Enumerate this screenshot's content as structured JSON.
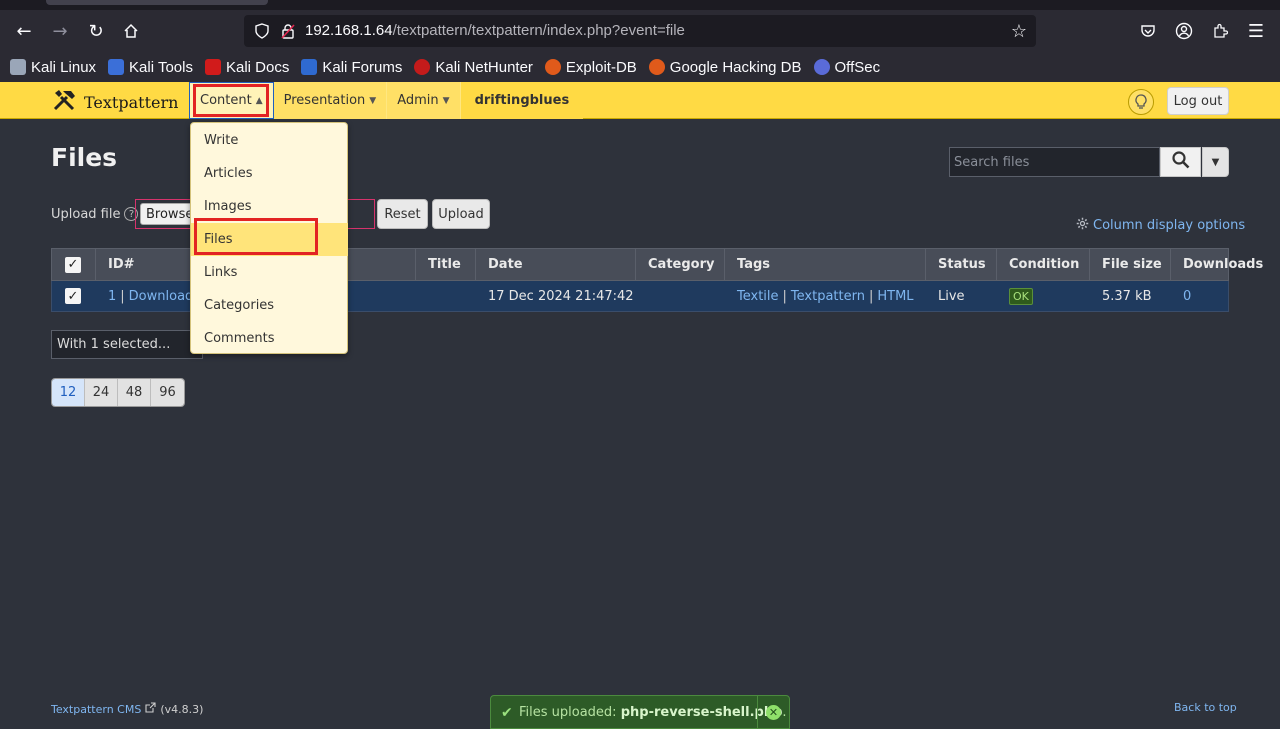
{
  "browser": {
    "url_host": "192.168.1.64",
    "url_path": "/textpattern/textpattern/index.php?event=file",
    "bookmarks": [
      {
        "label": "Kali Linux",
        "icon": "kali-dragon-icon",
        "color": "#9aa6b8"
      },
      {
        "label": "Kali Tools",
        "icon": "kali-tools-icon",
        "color": "#3b6fd8"
      },
      {
        "label": "Kali Docs",
        "icon": "kali-docs-icon",
        "color": "#d11b1b"
      },
      {
        "label": "Kali Forums",
        "icon": "kali-forums-icon",
        "color": "#2f6ad0"
      },
      {
        "label": "Kali NetHunter",
        "icon": "nethunter-icon",
        "color": "#c41b1b"
      },
      {
        "label": "Exploit-DB",
        "icon": "exploit-db-icon",
        "color": "#e05a1b"
      },
      {
        "label": "Google Hacking DB",
        "icon": "ghdb-icon",
        "color": "#e05a1b"
      },
      {
        "label": "OffSec",
        "icon": "offsec-icon",
        "color": "#5a6bd8"
      }
    ]
  },
  "header": {
    "logo_text": "Textpattern",
    "nav": {
      "content": "Content",
      "presentation": "Presentation",
      "admin": "Admin",
      "site": "driftingblues"
    },
    "logout": "Log out"
  },
  "dropdown": {
    "items": [
      "Write",
      "Articles",
      "Images",
      "Files",
      "Links",
      "Categories",
      "Comments"
    ],
    "active": "Files"
  },
  "page": {
    "title": "Files",
    "search_placeholder": "Search files",
    "upload_label": "Upload file",
    "help": "?",
    "browse": "Browse...",
    "reset": "Reset",
    "upload": "Upload",
    "column_options": "Column display options"
  },
  "table": {
    "headers": [
      "ID#",
      "Title",
      "Date",
      "Category",
      "Tags",
      "Status",
      "Condition",
      "File size",
      "Downloads"
    ],
    "row": {
      "id": "1",
      "download": "Download",
      "date": "17 Dec 2024 21:47:42",
      "tags": [
        "Textile",
        "Textpattern",
        "HTML"
      ],
      "status": "Live",
      "condition": "OK",
      "file_size": "5.37 kB",
      "downloads": "0"
    }
  },
  "bulk": {
    "label": "With 1 selected..."
  },
  "pager": {
    "sizes": [
      "12",
      "24",
      "48",
      "96"
    ],
    "active": "12"
  },
  "footer": {
    "cms": "Textpattern CMS",
    "version": "(v4.8.3)",
    "back_to_top": "Back to top"
  },
  "toast": {
    "prefix": "Files uploaded:",
    "filename": "php-reverse-shell.php",
    "suffix": "."
  },
  "colors": {
    "header_yellow": "#ffda44",
    "highlight_red": "#e22323",
    "link_blue": "#7fb6f0",
    "success_green": "#2d5b27"
  }
}
